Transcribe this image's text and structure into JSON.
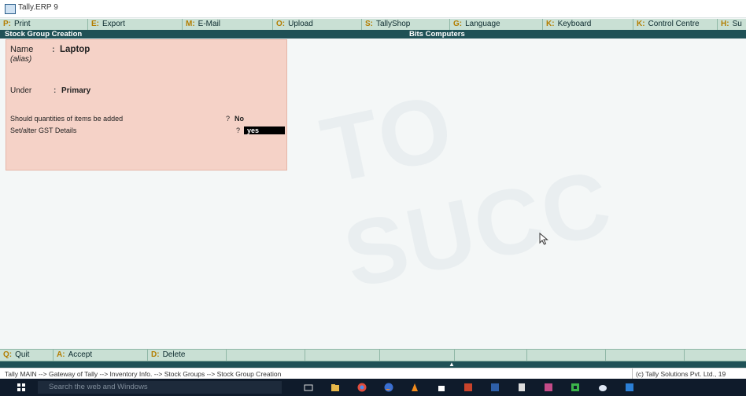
{
  "window": {
    "title": "Tally.ERP 9"
  },
  "topbar": {
    "items": [
      {
        "key": "P:",
        "label": "Print"
      },
      {
        "key": "E:",
        "label": "Export"
      },
      {
        "key": "M:",
        "label": "E-Mail"
      },
      {
        "key": "O:",
        "label": "Upload"
      },
      {
        "key": "S:",
        "label": "TallyShop"
      },
      {
        "key": "G:",
        "label": "Language"
      },
      {
        "key": "K:",
        "label": "Keyboard"
      },
      {
        "key": "K:",
        "label": "Control Centre"
      },
      {
        "key": "H:",
        "label": "Su"
      }
    ]
  },
  "header": {
    "screen_title": "Stock Group Creation",
    "company": "Bits Computers"
  },
  "form": {
    "name_label": "Name",
    "name_value": "Laptop",
    "alias_label": "(alias)",
    "under_label": "Under",
    "under_value": "Primary",
    "qty_label": "Should quantities of items be added",
    "qty_value": "No",
    "gst_label": "Set/alter GST Details",
    "gst_value": "yes"
  },
  "bottombar": {
    "buttons": [
      {
        "key": "Q:",
        "label": "Quit"
      },
      {
        "key": "A:",
        "label": "Accept"
      },
      {
        "key": "D:",
        "label": "Delete"
      }
    ]
  },
  "statusbar": {
    "breadcrumb": "Tally MAIN --> Gateway of Tally --> Inventory Info. --> Stock Groups --> Stock Group Creation",
    "copyright": "(c) Tally Solutions Pvt. Ltd., 19"
  },
  "taskbar": {
    "search_placeholder": "Search the web and Windows"
  },
  "colors": {
    "form_bg": "#f5d2c7",
    "header_teal": "#1f5156",
    "menu_green": "#c9e0d4"
  },
  "watermark": "TO SUCC"
}
